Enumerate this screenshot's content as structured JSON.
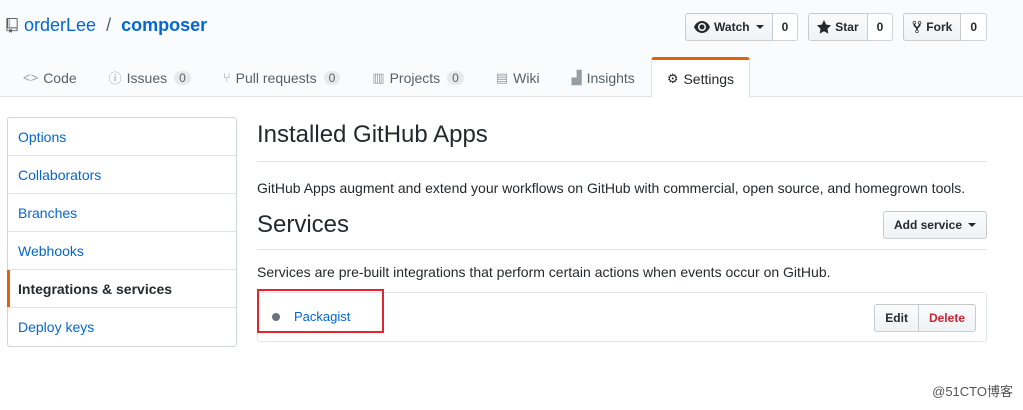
{
  "repo": {
    "owner": "orderLee",
    "separator": "/",
    "name": "composer"
  },
  "actions": [
    {
      "label": "Watch",
      "count": "0",
      "icon": "eye-icon"
    },
    {
      "label": "Star",
      "count": "0",
      "icon": "star-icon"
    },
    {
      "label": "Fork",
      "count": "0",
      "icon": "fork-icon"
    }
  ],
  "tabs": [
    {
      "label": "Code",
      "counter": "",
      "icon": "code-icon"
    },
    {
      "label": "Issues",
      "counter": "0",
      "icon": "issue-icon"
    },
    {
      "label": "Pull requests",
      "counter": "0",
      "icon": "pull-request-icon"
    },
    {
      "label": "Projects",
      "counter": "0",
      "icon": "project-icon"
    },
    {
      "label": "Wiki",
      "counter": "",
      "icon": "book-icon"
    },
    {
      "label": "Insights",
      "counter": "",
      "icon": "graph-icon"
    },
    {
      "label": "Settings",
      "counter": "",
      "icon": "gear-icon",
      "selected": true
    }
  ],
  "menu": [
    {
      "label": "Options"
    },
    {
      "label": "Collaborators"
    },
    {
      "label": "Branches"
    },
    {
      "label": "Webhooks"
    },
    {
      "label": "Integrations & services",
      "selected": true
    },
    {
      "label": "Deploy keys"
    }
  ],
  "main": {
    "apps_title": "Installed GitHub Apps",
    "apps_desc": "GitHub Apps augment and extend your workflows on GitHub with commercial, open source, and homegrown tools.",
    "services_title": "Services",
    "add_service": "Add service",
    "services_desc": "Services are pre-built integrations that perform certain actions when events occur on GitHub.",
    "service_name": "Packagist",
    "edit": "Edit",
    "delete": "Delete"
  },
  "watermark": "@51CTO博客",
  "colors": {
    "accent": "#e36209",
    "link": "#0366d6",
    "danger": "#cb2431",
    "highlight_box": "#e0262f"
  }
}
